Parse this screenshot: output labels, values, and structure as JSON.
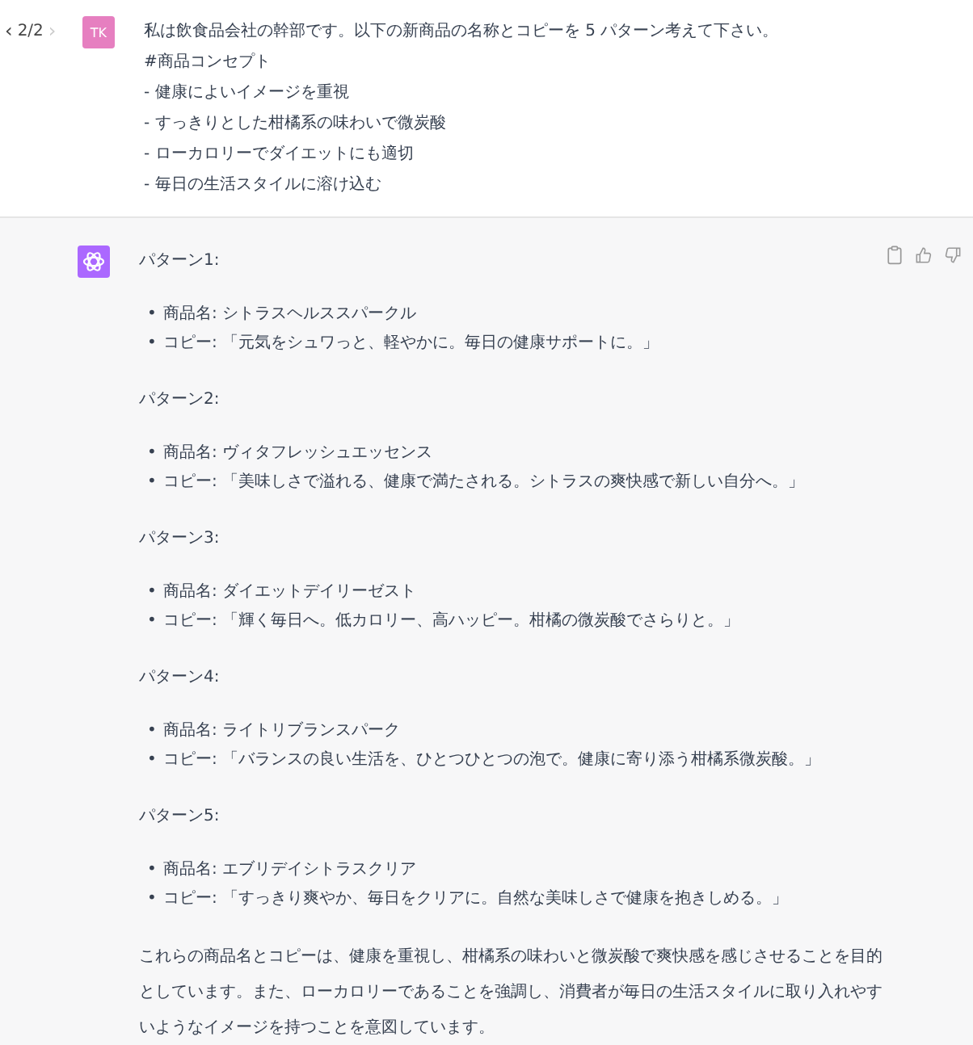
{
  "pager": {
    "prev": {
      "glyph": "‹",
      "disabled": false
    },
    "label": "2/2",
    "next": {
      "glyph": "›",
      "disabled": true
    }
  },
  "user_message": {
    "avatar": "TK",
    "lines": [
      "私は飲食品会社の幹部です。以下の新商品の名称とコピーを 5 パターン考えて下さい。",
      "#商品コンセプト",
      "- 健康によいイメージを重視",
      "- すっきりとした柑橘系の味わいで微炭酸",
      "- ローカロリーでダイエットにも適切",
      "- 毎日の生活スタイルに溶け込む"
    ]
  },
  "assistant_message": {
    "patterns": [
      {
        "heading": "パターン1:",
        "bullets": [
          {
            "marker": "•",
            "text": "商品名: シトラスヘルススパークル"
          },
          {
            "marker": "•",
            "text": "コピー: 「元気をシュワっと、軽やかに。毎日の健康サポートに。」"
          }
        ]
      },
      {
        "heading": "パターン2:",
        "bullets": [
          {
            "marker": "•",
            "text": "商品名: ヴィタフレッシュエッセンス"
          },
          {
            "marker": "•",
            "text": "コピー: 「美味しさで溢れる、健康で満たされる。シトラスの爽快感で新しい自分へ。」"
          }
        ]
      },
      {
        "heading": "パターン3:",
        "bullets": [
          {
            "marker": "•",
            "text": "商品名: ダイエットデイリーゼスト"
          },
          {
            "marker": "•",
            "text": "コピー: 「輝く毎日へ。低カロリー、高ハッピー。柑橘の微炭酸でさらりと。」"
          }
        ]
      },
      {
        "heading": "パターン4:",
        "bullets": [
          {
            "marker": "•",
            "text": "商品名: ライトリブランスパーク"
          },
          {
            "marker": "•",
            "text": "コピー: 「バランスの良い生活を、ひとつひとつの泡で。健康に寄り添う柑橘系微炭酸。」"
          }
        ]
      },
      {
        "heading": "パターン5:",
        "bullets": [
          {
            "marker": "•",
            "text": "商品名: エブリデイシトラスクリア"
          },
          {
            "marker": "•",
            "text": "コピー: 「すっきり爽やか、毎日をクリアに。自然な美味しさで健康を抱きしめる。」"
          }
        ]
      }
    ],
    "summary": "これらの商品名とコピーは、健康を重視し、柑橘系の味わいと微炭酸で爽快感を感じさせることを目的としています。また、ローカロリーであることを強調し、消費者が毎日の生活スタイルに取り入れやすいようなイメージを持つことを意図しています。"
  }
}
